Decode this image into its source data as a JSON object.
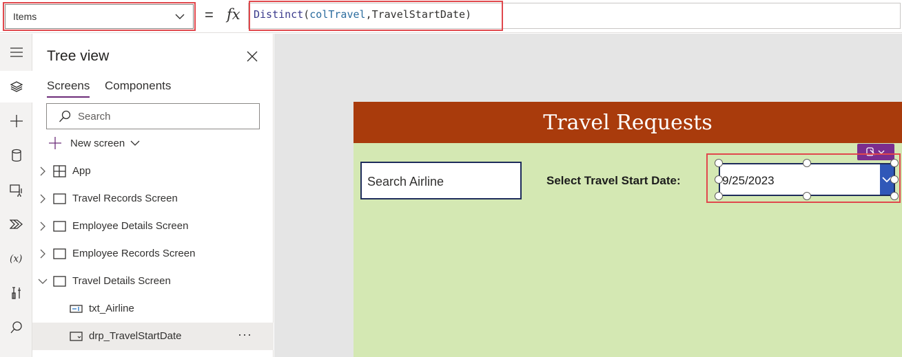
{
  "formula_bar": {
    "property": "Items",
    "equals": "=",
    "fx": "fx",
    "formula": {
      "function": "Distinct",
      "open_paren": "(",
      "collection": "colTravel",
      "separator": ",",
      "field": "TravelStartDate",
      "close_paren": ")"
    }
  },
  "rail": {
    "items": [
      "hamburger-icon",
      "layers-icon",
      "plus-icon",
      "database-icon",
      "media-icon",
      "power-automate-icon",
      "variables-icon",
      "tools-icon",
      "search-icon"
    ],
    "active_index": 1
  },
  "tree_view": {
    "title": "Tree view",
    "tabs": [
      {
        "label": "Screens",
        "active": true
      },
      {
        "label": "Components",
        "active": false
      }
    ],
    "search_placeholder": "Search",
    "new_screen_label": "New screen",
    "rows": [
      {
        "label": "App",
        "icon": "app-icon",
        "expander": "right"
      },
      {
        "label": "Travel Records Screen",
        "icon": "screen-icon",
        "expander": "right"
      },
      {
        "label": "Employee Details Screen",
        "icon": "screen-icon",
        "expander": "right"
      },
      {
        "label": "Employee Records Screen",
        "icon": "screen-icon",
        "expander": "right"
      },
      {
        "label": "Travel Details Screen",
        "icon": "screen-icon",
        "expander": "down"
      },
      {
        "label": "txt_Airline",
        "icon": "text-input-icon",
        "expander": "none"
      },
      {
        "label": "drp_TravelStartDate",
        "icon": "dropdown-icon",
        "expander": "none",
        "selected": true,
        "more": "···"
      }
    ]
  },
  "app_screen": {
    "title": "Travel Requests",
    "search_input_text": "Search Airline",
    "date_label": "Select Travel Start Date:",
    "dropdown_value": "9/25/2023",
    "colors": {
      "header": "#a93b0c",
      "body": "#d4e8b3",
      "accent": "#3058b8",
      "highlight": "#e0474c",
      "copilot": "#7b2d8e"
    }
  }
}
